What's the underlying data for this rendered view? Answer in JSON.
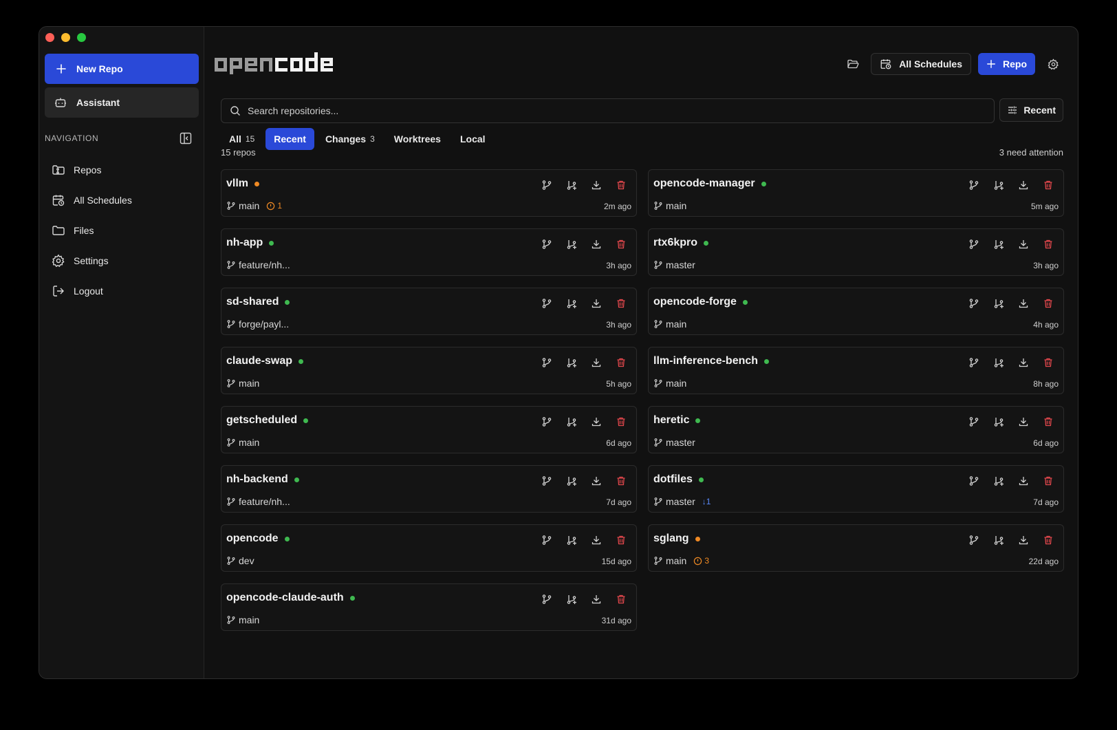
{
  "sidebar": {
    "new_repo_label": "New Repo",
    "assistant_label": "Assistant",
    "nav_heading": "NAVIGATION",
    "items": [
      {
        "label": "Repos",
        "icon": "repos-icon"
      },
      {
        "label": "All Schedules",
        "icon": "calendar-clock-icon"
      },
      {
        "label": "Files",
        "icon": "folder-icon"
      },
      {
        "label": "Settings",
        "icon": "gear-icon"
      },
      {
        "label": "Logout",
        "icon": "logout-icon"
      }
    ]
  },
  "header": {
    "logo_part1": "open",
    "logo_part2": "code",
    "schedules_label": "All Schedules",
    "repo_button_label": "Repo"
  },
  "search": {
    "placeholder": "Search repositories...",
    "value": ""
  },
  "sort_label": "Recent",
  "tabs": [
    {
      "label": "All",
      "count": "15"
    },
    {
      "label": "Recent",
      "count": ""
    },
    {
      "label": "Changes",
      "count": "3"
    },
    {
      "label": "Worktrees",
      "count": ""
    },
    {
      "label": "Local",
      "count": ""
    }
  ],
  "active_tab": "Recent",
  "repo_count_text": "15 repos",
  "attention_text": "3 need attention",
  "status_colors": {
    "ok": "#3fb950",
    "warn": "#f08a24",
    "accent": "#2a49d8",
    "danger": "#e5484d"
  },
  "repos": [
    {
      "name": "vllm",
      "status": "warn",
      "branch": "main",
      "badge": "1",
      "badge_type": "warn",
      "time": "2m ago"
    },
    {
      "name": "opencode-manager",
      "status": "ok",
      "branch": "main",
      "badge": "",
      "badge_type": "",
      "time": "5m ago"
    },
    {
      "name": "nh-app",
      "status": "ok",
      "branch": "feature/nh...",
      "badge": "",
      "badge_type": "",
      "time": "3h ago"
    },
    {
      "name": "rtx6kpro",
      "status": "ok",
      "branch": "master",
      "badge": "",
      "badge_type": "",
      "time": "3h ago"
    },
    {
      "name": "sd-shared",
      "status": "ok",
      "branch": "forge/payl...",
      "badge": "",
      "badge_type": "",
      "time": "3h ago"
    },
    {
      "name": "opencode-forge",
      "status": "ok",
      "branch": "main",
      "badge": "",
      "badge_type": "",
      "time": "4h ago"
    },
    {
      "name": "claude-swap",
      "status": "ok",
      "branch": "main",
      "badge": "",
      "badge_type": "",
      "time": "5h ago"
    },
    {
      "name": "llm-inference-bench",
      "status": "ok",
      "branch": "main",
      "badge": "",
      "badge_type": "",
      "time": "8h ago"
    },
    {
      "name": "getscheduled",
      "status": "ok",
      "branch": "main",
      "badge": "",
      "badge_type": "",
      "time": "6d ago"
    },
    {
      "name": "heretic",
      "status": "ok",
      "branch": "master",
      "badge": "",
      "badge_type": "",
      "time": "6d ago"
    },
    {
      "name": "nh-backend",
      "status": "ok",
      "branch": "feature/nh...",
      "badge": "",
      "badge_type": "",
      "time": "7d ago"
    },
    {
      "name": "dotfiles",
      "status": "ok",
      "branch": "master",
      "badge": "↓1",
      "badge_type": "behind",
      "time": "7d ago"
    },
    {
      "name": "opencode",
      "status": "ok",
      "branch": "dev",
      "badge": "",
      "badge_type": "",
      "time": "15d ago"
    },
    {
      "name": "sglang",
      "status": "warn",
      "branch": "main",
      "badge": "3",
      "badge_type": "warn",
      "time": "22d ago"
    },
    {
      "name": "opencode-claude-auth",
      "status": "ok",
      "branch": "main",
      "badge": "",
      "badge_type": "",
      "time": "31d ago"
    }
  ]
}
